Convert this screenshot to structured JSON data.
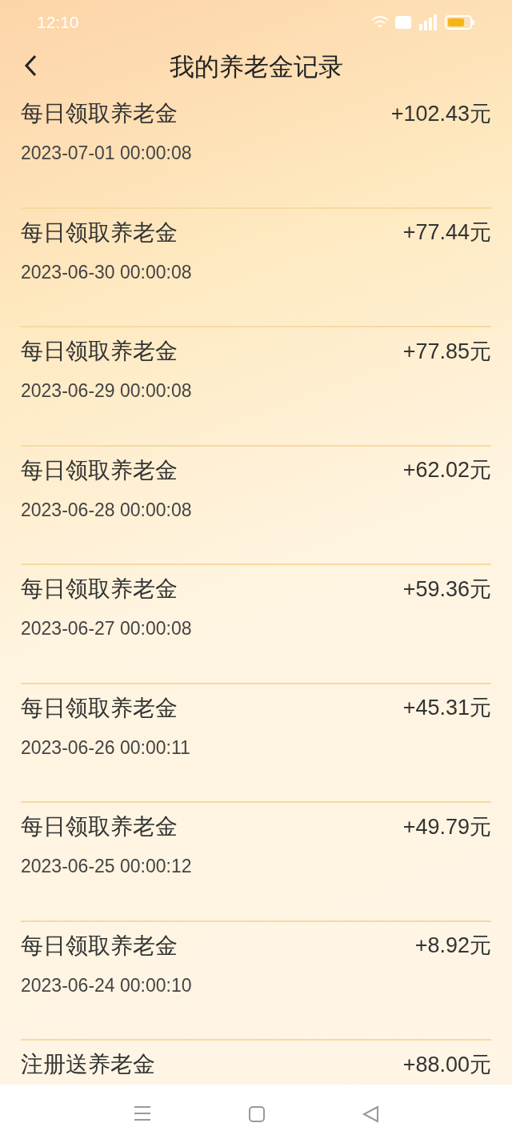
{
  "status_bar": {
    "time": "12:10"
  },
  "header": {
    "title": "我的养老金记录"
  },
  "records": [
    {
      "title": "每日领取养老金",
      "time": "2023-07-01 00:00:08",
      "amount": "+102.43元"
    },
    {
      "title": "每日领取养老金",
      "time": "2023-06-30 00:00:08",
      "amount": "+77.44元"
    },
    {
      "title": "每日领取养老金",
      "time": "2023-06-29 00:00:08",
      "amount": "+77.85元"
    },
    {
      "title": "每日领取养老金",
      "time": "2023-06-28 00:00:08",
      "amount": "+62.02元"
    },
    {
      "title": "每日领取养老金",
      "time": "2023-06-27 00:00:08",
      "amount": "+59.36元"
    },
    {
      "title": "每日领取养老金",
      "time": "2023-06-26 00:00:11",
      "amount": "+45.31元"
    },
    {
      "title": "每日领取养老金",
      "time": "2023-06-25 00:00:12",
      "amount": "+49.79元"
    },
    {
      "title": "每日领取养老金",
      "time": "2023-06-24 00:00:10",
      "amount": "+8.92元"
    },
    {
      "title": "注册送养老金",
      "amount": "+88.00元"
    }
  ]
}
